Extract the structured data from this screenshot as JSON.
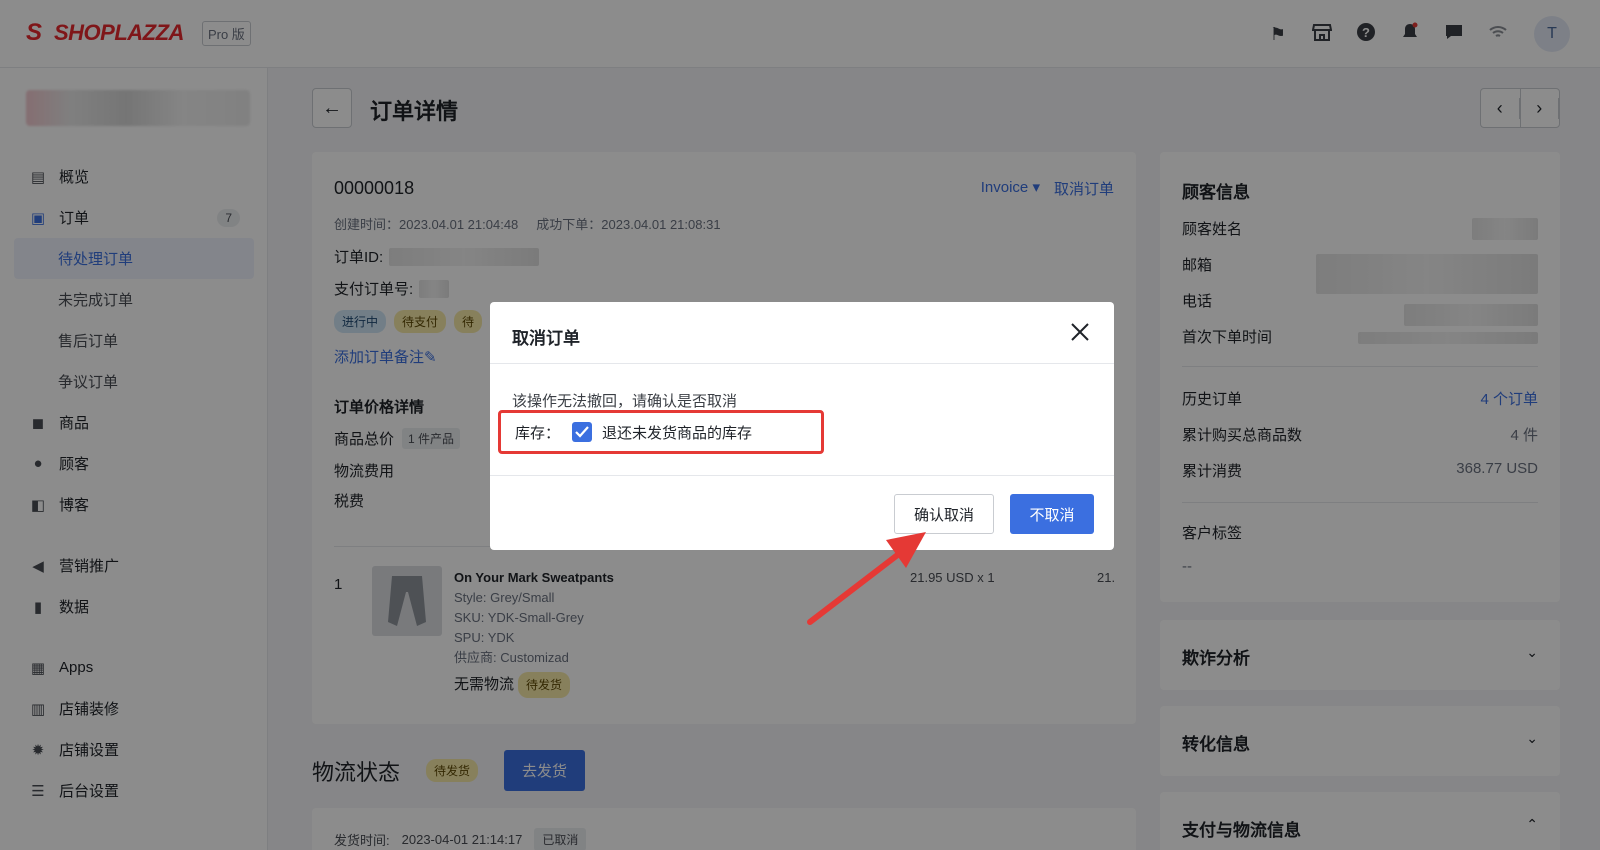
{
  "header": {
    "logo_text": "SHOPLAZZA",
    "plan_badge": "Pro 版",
    "avatar_initial": "T"
  },
  "sidebar": {
    "items": [
      {
        "label": "概览",
        "icon": "dashboard-icon"
      },
      {
        "label": "订单",
        "icon": "inbox-icon",
        "count": "7"
      },
      {
        "label": "待处理订单"
      },
      {
        "label": "未完成订单"
      },
      {
        "label": "售后订单"
      },
      {
        "label": "争议订单"
      },
      {
        "label": "商品",
        "icon": "bag-icon"
      },
      {
        "label": "顾客",
        "icon": "person-icon"
      },
      {
        "label": "博客",
        "icon": "blog-icon"
      },
      {
        "label": "营销推广",
        "icon": "megaphone-icon"
      },
      {
        "label": "数据",
        "icon": "bar-chart-icon"
      },
      {
        "label": "Apps",
        "icon": "apps-icon"
      },
      {
        "label": "店铺装修",
        "icon": "store-icon"
      },
      {
        "label": "店铺设置",
        "icon": "gear-icon"
      },
      {
        "label": "后台设置",
        "icon": "server-icon"
      }
    ]
  },
  "page": {
    "title": "订单详情"
  },
  "order": {
    "number": "00000018",
    "invoice_label": "Invoice",
    "cancel_link": "取消订单",
    "created": "创建时间：2023.04.01 21:04:48",
    "success": "成功下单：2023.04.01 21:08:31",
    "order_id_label": "订单ID:",
    "pay_id_label": "支付订单号:",
    "tags": [
      "进行中",
      "待支付",
      "待"
    ],
    "add_note": "添加订单备注",
    "price_title": "订单价格详情",
    "price_rows": [
      "商品总价",
      "物流费用",
      "税费"
    ],
    "product_count_chip": "1 件产品",
    "line_index": "1",
    "product": {
      "name": "On Your Mark Sweatpants",
      "style": "Style: Grey/Small",
      "sku": "SKU: YDK-Small-Grey",
      "spu": "SPU: YDK",
      "vendor": "供应商: Customizad",
      "shipping": "无需物流",
      "ship_tag": "待发货",
      "price": "21.95 USD x 1",
      "total": "21."
    }
  },
  "shipping": {
    "title": "物流状态",
    "status_tag": "待发货",
    "ship_button": "去发货",
    "ship_time_label": "发货时间:",
    "ship_time": "2023-04-01 21:14:17",
    "ship_status": "已取消"
  },
  "customer": {
    "title": "顾客信息",
    "fields": [
      "顾客姓名",
      "邮箱",
      "电话",
      "首次下单时间"
    ],
    "history_label": "历史订单",
    "history_value": "4 个订单",
    "items_label": "累计购买总商品数",
    "items_value": "4 件",
    "spend_label": "累计消费",
    "spend_value": "368.77 USD",
    "tags_label": "客户标签",
    "tags_value": "--"
  },
  "sections": {
    "fraud": "欺诈分析",
    "conversion": "转化信息",
    "payment": "支付与物流信息"
  },
  "modal": {
    "title": "取消订单",
    "message": "该操作无法撤回，请确认是否取消",
    "inventory_label": "库存：",
    "restock_checked": true,
    "restock_label": "退还未发货商品的库存",
    "confirm_button": "确认取消",
    "keep_button": "不取消"
  },
  "colors": {
    "primary": "#3b6fe0",
    "brand": "#e8292f",
    "highlight": "#e53935"
  }
}
